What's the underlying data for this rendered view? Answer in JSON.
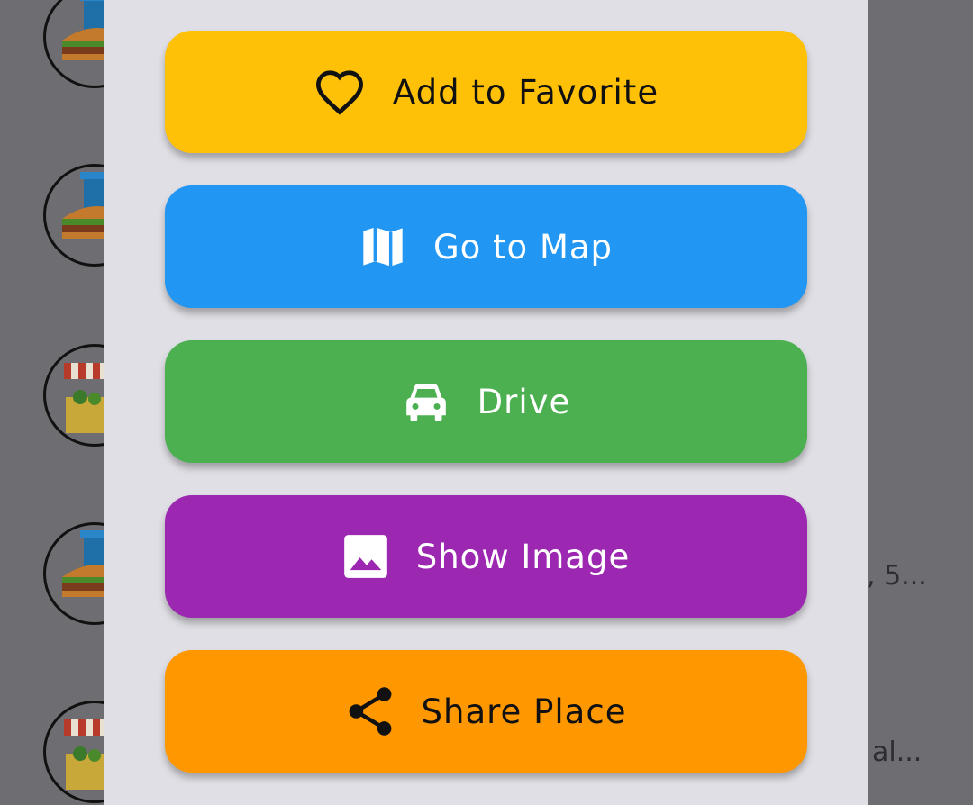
{
  "background_list": {
    "items": [
      {
        "icon": "fast-food-icon"
      },
      {
        "icon": "fast-food-icon"
      },
      {
        "icon": "market-stall-icon"
      },
      {
        "icon": "fast-food-icon",
        "text": ", 5..."
      },
      {
        "icon": "market-stall-icon",
        "text": "al..."
      }
    ]
  },
  "dialog": {
    "buttons": [
      {
        "label": "Add to Favorite",
        "icon": "heart-outline-icon",
        "color": "#ffc107",
        "text_color": "#111111"
      },
      {
        "label": "Go to Map",
        "icon": "map-icon",
        "color": "#2196f3",
        "text_color": "#ffffff"
      },
      {
        "label": "Drive",
        "icon": "car-icon",
        "color": "#4caf50",
        "text_color": "#ffffff"
      },
      {
        "label": "Show Image",
        "icon": "image-icon",
        "color": "#9c27b0",
        "text_color": "#ffffff"
      },
      {
        "label": "Share Place",
        "icon": "share-icon",
        "color": "#ff9800",
        "text_color": "#111111"
      }
    ]
  }
}
